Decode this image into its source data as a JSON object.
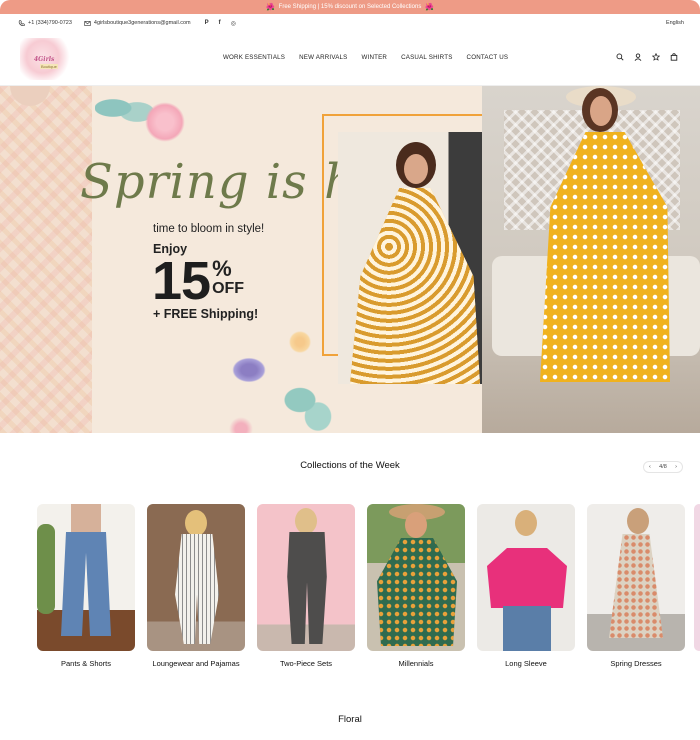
{
  "announcement": {
    "left_emoji": "🌺",
    "text": "Free Shipping | 15% discount on Selected Collections",
    "right_emoji": "🌺"
  },
  "utility": {
    "phone": "+1 (334)790-0723",
    "email": "4girlsboutique3generations@gmail.com",
    "social": [
      "pinterest-icon",
      "facebook-icon",
      "instagram-icon"
    ],
    "social_glyphs": [
      "P",
      "f",
      "◎"
    ],
    "language": "English"
  },
  "header": {
    "logo_text": "4Girls",
    "logo_sub": "Boutique",
    "nav": [
      "WORK ESSENTIALS",
      "NEW ARRIVALS",
      "WINTER",
      "CASUAL SHIRTS",
      "CONTACT US"
    ],
    "icons": [
      "search-icon",
      "account-icon",
      "wishlist-icon",
      "cart-icon"
    ]
  },
  "hero": {
    "title": "Spring is here",
    "tagline": "time to bloom in style!",
    "enjoy": "Enjoy",
    "percent": "15",
    "percent_sign": "%",
    "off": "OFF",
    "free_shipping": "+ FREE Shipping!"
  },
  "collections": {
    "title": "Collections of the Week",
    "pager": "4/8",
    "items": [
      {
        "label": "Pants & Shorts"
      },
      {
        "label": "Loungewear and Pajamas"
      },
      {
        "label": "Two-Piece Sets"
      },
      {
        "label": "Millennials"
      },
      {
        "label": "Long Sleeve"
      },
      {
        "label": "Spring Dresses"
      }
    ]
  },
  "floral": {
    "title": "Floral"
  },
  "colors": {
    "announcement_bg": "#ee9b86",
    "hero_bg": "#f5e9dc",
    "accent_orange": "#f0a23a",
    "script_green": "#6e7a4b"
  }
}
